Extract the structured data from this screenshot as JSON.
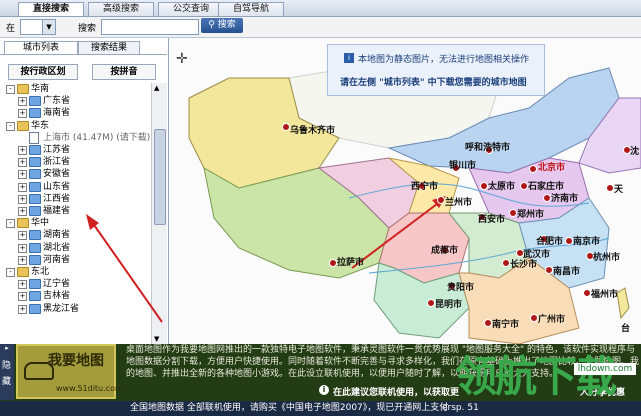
{
  "tabs": [
    "直接搜索",
    "高级搜索",
    "公交查询",
    "自驾导航"
  ],
  "search": {
    "in_label": "在",
    "search_label": "搜索",
    "button": "搜索"
  },
  "panel": {
    "tabs": [
      "城市列表",
      "搜索结果"
    ],
    "buttons": [
      "按行政区划",
      "按拼音"
    ],
    "tree": [
      {
        "text": "华南",
        "level": 0,
        "expander": "-",
        "icon": "folder"
      },
      {
        "text": "广东省",
        "level": 1,
        "expander": "+",
        "icon": "folder-blue"
      },
      {
        "text": "海南省",
        "level": 1,
        "expander": "+",
        "icon": "folder-blue"
      },
      {
        "text": "华东",
        "level": 0,
        "expander": "-",
        "icon": "folder"
      },
      {
        "text": "上海市 (41.47M) (请下载)",
        "level": 1,
        "expander": "",
        "icon": "doc"
      },
      {
        "text": "江苏省",
        "level": 1,
        "expander": "+",
        "icon": "folder-blue"
      },
      {
        "text": "浙江省",
        "level": 1,
        "expander": "+",
        "icon": "folder-blue"
      },
      {
        "text": "安徽省",
        "level": 1,
        "expander": "+",
        "icon": "folder-blue"
      },
      {
        "text": "山东省",
        "level": 1,
        "expander": "+",
        "icon": "folder-blue"
      },
      {
        "text": "江西省",
        "level": 1,
        "expander": "+",
        "icon": "folder-blue"
      },
      {
        "text": "福建省",
        "level": 1,
        "expander": "+",
        "icon": "folder-blue"
      },
      {
        "text": "华中",
        "level": 0,
        "expander": "-",
        "icon": "folder"
      },
      {
        "text": "湖南省",
        "level": 1,
        "expander": "+",
        "icon": "folder-blue"
      },
      {
        "text": "湖北省",
        "level": 1,
        "expander": "+",
        "icon": "folder-blue"
      },
      {
        "text": "河南省",
        "level": 1,
        "expander": "+",
        "icon": "folder-blue"
      },
      {
        "text": "东北",
        "level": 0,
        "expander": "-",
        "icon": "folder"
      },
      {
        "text": "辽宁省",
        "level": 1,
        "expander": "+",
        "icon": "folder-blue"
      },
      {
        "text": "吉林省",
        "level": 1,
        "expander": "+",
        "icon": "folder-blue"
      },
      {
        "text": "黑龙江省",
        "level": 1,
        "expander": "+",
        "icon": "folder-blue"
      }
    ]
  },
  "map": {
    "notice_line1": "本地图为静态图片，无法进行地图相关操作",
    "notice_line2": "请在左侧 \"城市列表\" 中下载您需要的城市地图",
    "cities": [
      "乌鲁木齐市",
      "呼和浩特市",
      "银川市",
      "北京市",
      "沈",
      "西宁市",
      "太原市",
      "石家庄市",
      "天",
      "兰州市",
      "济南市",
      "西安市",
      "郑州市",
      "成都市",
      "合肥市",
      "南京市",
      "拉萨市",
      "武汉市",
      "杭州市",
      "长沙市",
      "南昌市",
      "贵阳市",
      "福州市",
      "昆明市",
      "南宁市",
      "广州市",
      "台"
    ]
  },
  "bottom": {
    "side_label": "隐藏",
    "logo_text": "我要地图",
    "logo_url": "www.51ditu.com",
    "desc": "桌面地图作为我要地图网推出的一款独特电子地图软件，秉承灵图软件一贯优势展现 \"地图服务大全\" 的特色，该软件实现程序与地图数据分割下载，方便用户快捷使用。同时随着软件不断完善与寻求多样化，我们在原有基础上推出了地图比较、专题地图、我的地图、并推出全新的各种地图小游戏。在此设立联机使用，以便用户随时了解，以期获得用户的大力支持。",
    "tip": "在此建议您联机使用，以获取更",
    "tip_tail": "人分享优惠",
    "status": "全国地图数据 全部联机使用，请购买《中国电子地图2007》，现已开通网上支付",
    "status_tail": "ersp. 51"
  },
  "watermark": {
    "text": "领航下载",
    "url": "lhdown.com"
  }
}
